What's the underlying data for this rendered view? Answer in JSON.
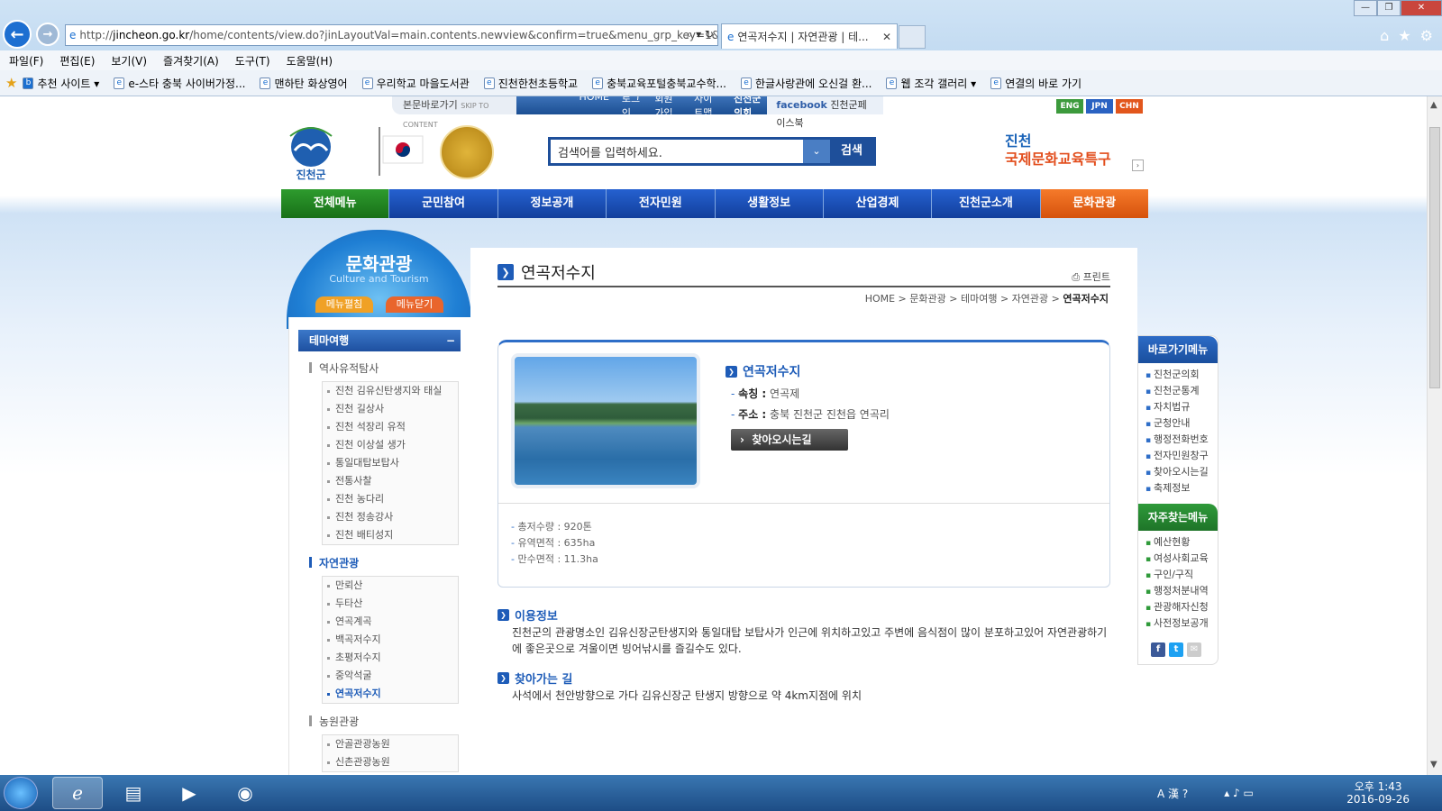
{
  "browser": {
    "url_prefix": "http://",
    "url_domain": "jincheon.go.kr",
    "url_rest": "/home/contents/view.do?jinLayoutVal=main.contents.newview&confirm=true&menu_grp_key=1&",
    "tab_title": "연곡저수지 | 자연관광 | 테...",
    "menu": [
      "파일(F)",
      "편집(E)",
      "보기(V)",
      "즐겨찾기(A)",
      "도구(T)",
      "도움말(H)"
    ],
    "favorites": [
      "추천 사이트 ▾",
      "e-스타 충북 사이버가정...",
      "맨하탄 화상영어",
      "우리학교 마을도서관",
      "진천한천초등학교",
      "충북교육포털충북교수학...",
      "한글사랑관에 오신걸 환...",
      "웹 조각 갤러리 ▾",
      "연결의 바로 가기"
    ]
  },
  "util": {
    "skip": "본문바로가기",
    "skip_en": "SKIP TO CONTENT",
    "links": [
      "HOME",
      "로그인",
      "회원가입",
      "사이트맵",
      "진천군의회"
    ],
    "facebook_brand": "facebook",
    "facebook_text": "진천군페이스북",
    "langs": [
      "ENG",
      "JPN",
      "CHN"
    ]
  },
  "header": {
    "logo_text": "진천군",
    "search_placeholder": "검색어를 입력하세요.",
    "search_button": "검색",
    "special_line1": "진천",
    "special_line2": "국제문화교육특구"
  },
  "gnb": [
    "전체메뉴",
    "군민참여",
    "정보공개",
    "전자민원",
    "생활정보",
    "산업경제",
    "진천군소개",
    "문화관광"
  ],
  "lnb": {
    "title": "문화관광",
    "subtitle": "Culture and Tourism",
    "open_btn": "메뉴펼침",
    "close_btn": "메뉴닫기",
    "category": "테마여행",
    "group1": "역사유적탐사",
    "group1_items": [
      "진천 김유신탄생지와 태실",
      "진천 길상사",
      "진천 석장리 유적",
      "진천 이상설 생가",
      "통일대탑보탑사",
      "전통사찰",
      "진천 농다리",
      "진천 정송강사",
      "진천 배티성지"
    ],
    "group2": "자연관광",
    "group2_items": [
      "만뢰산",
      "두타산",
      "연곡계곡",
      "백곡저수지",
      "초평저수지",
      "중악석굴",
      "연곡저수지"
    ],
    "group3": "농원관광",
    "group3_items": [
      "안골관광농원",
      "신촌관광농원"
    ]
  },
  "content": {
    "title": "연곡저수지",
    "print": "프린트",
    "breadcrumb": [
      "HOME",
      "문화관광",
      "테마여행",
      "자연관광",
      "연곡저수지"
    ],
    "name": "연곡저수지",
    "alias_label": "속칭 :",
    "alias_value": "연곡제",
    "addr_label": "주소 :",
    "addr_value": "충북 진천군 진천읍 연곡리",
    "find_btn": "찾아오시는길",
    "stats": [
      "총저수량 : 920톤",
      "유역면적 : 635ha",
      "만수면적 : 11.3ha"
    ],
    "info_title": "이용정보",
    "info_text": "진천군의 관광명소인 김유신장군탄생지와 통일대탑 보탑사가 인근에 위치하고있고 주변에 음식점이 많이 분포하고있어 자연관광하기에 좋은곳으로 겨울이면 빙어낚시를 즐길수도 있다.",
    "route_title": "찾아가는 길",
    "route_text": "사석에서 천안방향으로 가다 김유신장군 탄생지 방향으로 약 4km지점에 위치"
  },
  "quick": {
    "head1": "바로가기메뉴",
    "links1": [
      "진천군의회",
      "진천군통계",
      "자치법규",
      "군청안내",
      "행정전화번호",
      "전자민원창구",
      "찾아오시는길",
      "축제정보"
    ],
    "head2": "자주찾는메뉴",
    "links2": [
      "예산현황",
      "여성사회교육",
      "구인/구직",
      "행정처분내역",
      "관광해자신청",
      "사전정보공개"
    ]
  },
  "taskbar": {
    "time": "오후 1:43",
    "date": "2016-09-26"
  },
  "colors": {
    "brand_blue": "#1e5cb8",
    "gnb_green": "#187018",
    "gnb_orange": "#e9652c"
  }
}
